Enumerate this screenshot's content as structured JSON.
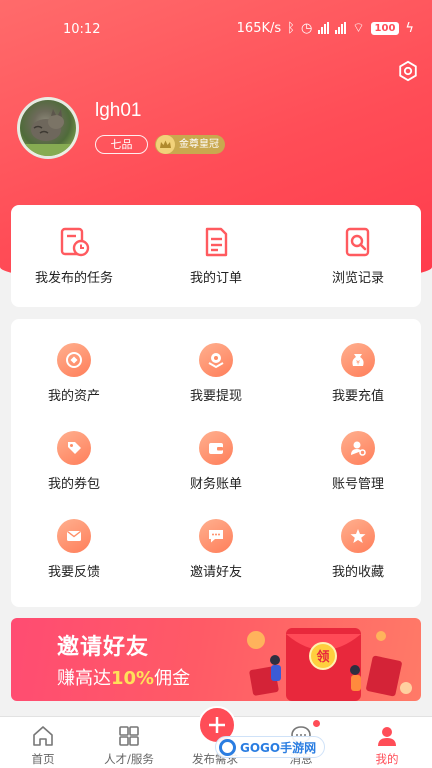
{
  "status_bar": {
    "time": "10:12",
    "speed": "165K/s",
    "battery": "100"
  },
  "profile": {
    "username": "lgh01",
    "rank": "七品",
    "vip": "金尊皇冠"
  },
  "quick_links": [
    {
      "label": "我发布的任务",
      "icon": "task-clock-icon"
    },
    {
      "label": "我的订单",
      "icon": "order-doc-icon"
    },
    {
      "label": "浏览记录",
      "icon": "browse-history-icon"
    }
  ],
  "services": [
    {
      "label": "我的资产",
      "icon": "assets-icon"
    },
    {
      "label": "我要提现",
      "icon": "withdraw-icon"
    },
    {
      "label": "我要充值",
      "icon": "recharge-icon"
    },
    {
      "label": "我的券包",
      "icon": "coupon-icon"
    },
    {
      "label": "财务账单",
      "icon": "wallet-bill-icon"
    },
    {
      "label": "账号管理",
      "icon": "account-manage-icon"
    },
    {
      "label": "我要反馈",
      "icon": "feedback-mail-icon"
    },
    {
      "label": "邀请好友",
      "icon": "invite-chat-icon"
    },
    {
      "label": "我的收藏",
      "icon": "favorite-star-icon"
    }
  ],
  "banner": {
    "title": "邀请好友",
    "subtitle_pre": "赚高达",
    "subtitle_highlight": "10%",
    "subtitle_post": "佣金",
    "envelope_text": "领"
  },
  "tabbar": [
    {
      "label": "首页",
      "icon": "home-icon"
    },
    {
      "label": "人才/服务",
      "icon": "grid-icon"
    },
    {
      "label": "发布需求",
      "icon": "plus-icon"
    },
    {
      "label": "消息",
      "icon": "message-icon"
    },
    {
      "label": "我的",
      "icon": "user-icon"
    }
  ],
  "watermark": "GOGO手游网",
  "colors": {
    "accent": "#ff4d57",
    "icon_gradient_start": "#ffb08f",
    "icon_gradient_end": "#ff7e5a",
    "vip_gold": "#c9a84f"
  }
}
